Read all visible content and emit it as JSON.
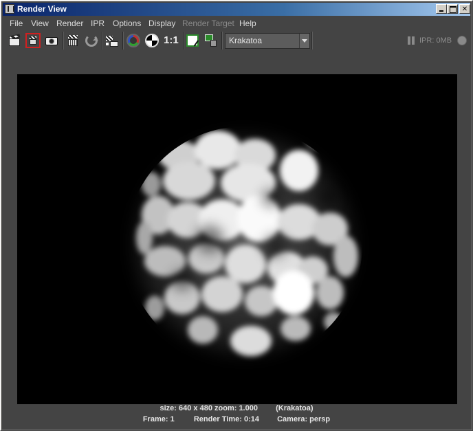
{
  "window": {
    "title": "Render View"
  },
  "menu": [
    "File",
    "View",
    "Render",
    "IPR",
    "Options",
    "Display",
    "Render Target",
    "Help"
  ],
  "menu_disabled": [
    "Render Target"
  ],
  "toolbar": {
    "icons": [
      "render-frame-icon",
      "render-region-icon",
      "snapshot-icon",
      "redo-previous-render-icon",
      "refresh-icon",
      "ipr-render-icon",
      "display-rgb-channels-icon",
      "display-alpha-channel-icon",
      "keep-image-icon",
      "remove-image-icon"
    ],
    "real_size_label": "1:1",
    "renderer": "Krakatoa",
    "ipr_status": "IPR: 0MB"
  },
  "render_info": {
    "size_zoom": "size: 640 x 480 zoom: 1.000",
    "renderer": "(Krakatoa)",
    "frame": "Frame: 1",
    "render_time": "Render Time: 0:14",
    "camera": "Camera: persp"
  }
}
